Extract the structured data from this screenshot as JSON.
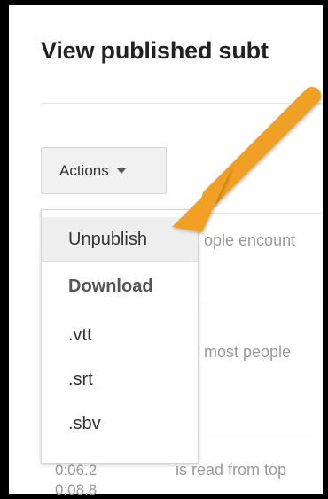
{
  "page": {
    "title": "View published subt"
  },
  "actions": {
    "label": "Actions"
  },
  "menu": {
    "items": [
      {
        "label": "Unpublish"
      },
      {
        "label": "Download"
      },
      {
        "label": ".vtt"
      },
      {
        "label": ".srt"
      },
      {
        "label": ".sbv"
      }
    ]
  },
  "background_rows": [
    {
      "text": "ople encount"
    },
    {
      "text": "most people"
    },
    {
      "text": "is read from top"
    },
    {
      "time1": "0:06.2",
      "time2": "0:08.8"
    }
  ],
  "colors": {
    "arrow": "#f0a020",
    "highlight": "#eeeeee"
  },
  "icons": {
    "dropdown": "caret-down-icon",
    "annotation": "arrow-annotation"
  }
}
